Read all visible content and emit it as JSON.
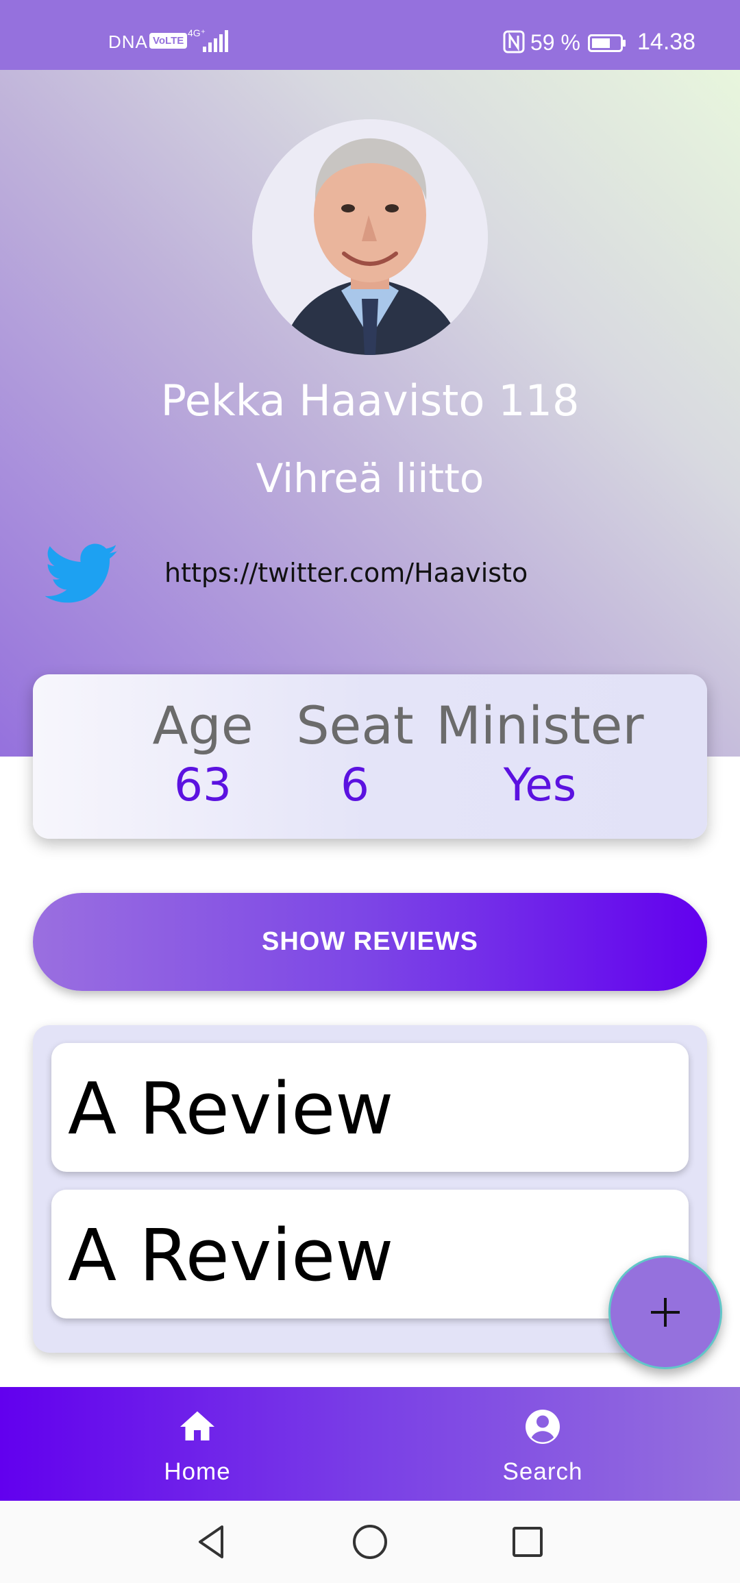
{
  "status_bar": {
    "carrier": "DNA",
    "volte": "VoLTE",
    "network": "4G⁺",
    "battery_percent": "59 %",
    "time": "14.38",
    "icons": [
      "signal-icon",
      "nfc-icon",
      "battery-icon"
    ]
  },
  "profile": {
    "name": "Pekka Haavisto 118",
    "party": "Vihreä liitto",
    "twitter_url": "https://twitter.com/Haavisto",
    "avatar_icon": "candidate-photo"
  },
  "stats": {
    "age_label": "Age",
    "age_value": "63",
    "seat_label": "Seat",
    "seat_value": "6",
    "minister_label": "Minister",
    "minister_value": "Yes"
  },
  "actions": {
    "show_reviews_label": "SHOW REVIEWS",
    "fab_icon": "plus-icon"
  },
  "reviews": [
    {
      "title": "A Review"
    },
    {
      "title": "A Review"
    }
  ],
  "bottom_nav": {
    "items": [
      {
        "label": "Home",
        "icon": "home-icon"
      },
      {
        "label": "Search",
        "icon": "account-icon"
      }
    ]
  },
  "colors": {
    "primary": "#6200ee",
    "accent_purple": "#9571dd",
    "stat_value": "#5b12e0",
    "twitter_blue": "#1da1f2"
  }
}
